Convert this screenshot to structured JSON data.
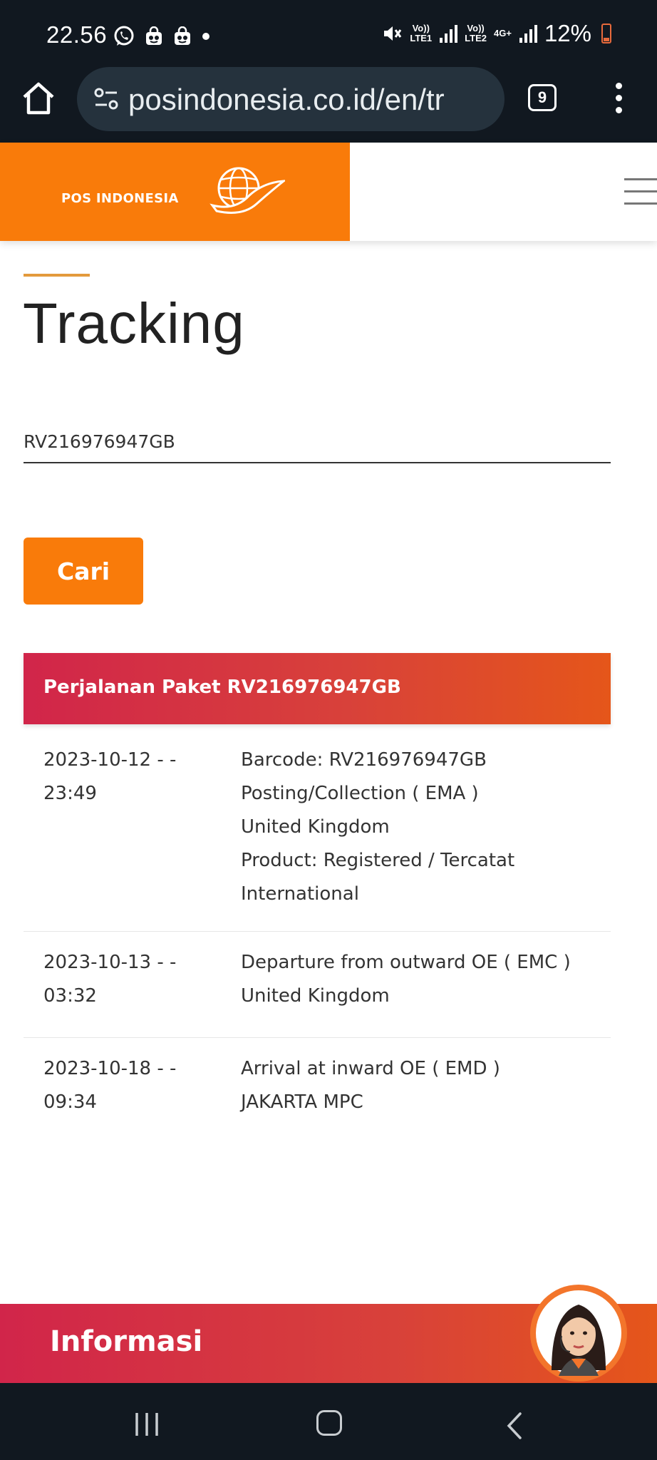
{
  "status_bar": {
    "time": "22.56",
    "sim1_label": "Vo))\nLTE1",
    "sim2_label": "Vo))\nLTE2",
    "network": "4G+",
    "battery": "12%",
    "icons": [
      "whatsapp-icon",
      "shopping-bag-icon",
      "shopping-bag-icon",
      "dot-icon",
      "mute-icon",
      "signal-icon",
      "battery-icon"
    ]
  },
  "browser": {
    "url": "posindonesia.co.id/en/tr",
    "tab_count": "9"
  },
  "header": {
    "brand": "POS INDONESIA"
  },
  "page": {
    "title": "Tracking",
    "tracking_number": "RV216976947GB",
    "search_label": "Cari"
  },
  "results": {
    "header": "Perjalanan Paket RV216976947GB",
    "events": [
      {
        "date": "2023-10-12 - -",
        "time": "23:49",
        "lines": [
          "Barcode: RV216976947GB",
          "Posting/Collection ( EMA )",
          "United Kingdom",
          "Product: Registered / Tercatat",
          "International"
        ]
      },
      {
        "date": "2023-10-13 - -",
        "time": "03:32",
        "lines": [
          "Departure from outward OE ( EMC )",
          "United Kingdom"
        ]
      },
      {
        "date": "2023-10-18 - -",
        "time": "09:34",
        "lines": [
          "Arrival at inward OE ( EMD )",
          "JAKARTA MPC"
        ]
      }
    ]
  },
  "footer": {
    "title": "Informasi"
  },
  "colors": {
    "brand_orange": "#f97b0a",
    "panel_red": "#d1254a",
    "panel_orange": "#e5561a",
    "system_bar": "#111820"
  }
}
